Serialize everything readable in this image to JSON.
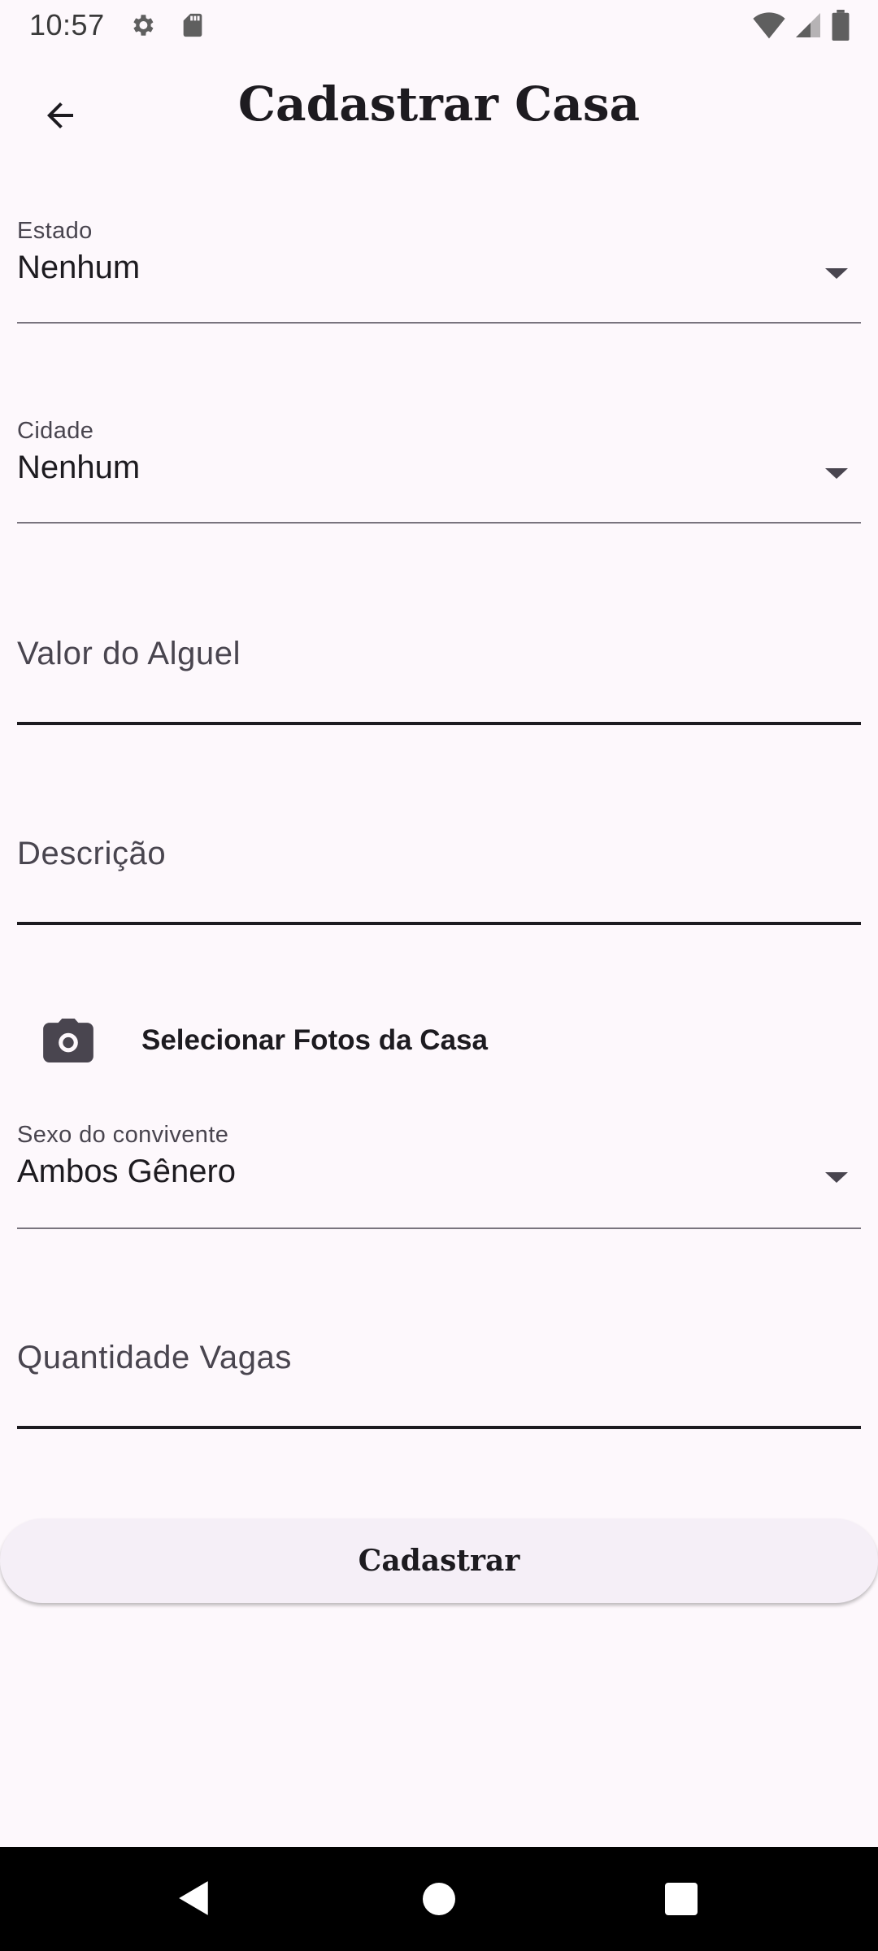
{
  "status_bar": {
    "time": "10:57",
    "icons": [
      "gear-icon",
      "sd-card-icon",
      "wifi-icon",
      "signal-icon",
      "battery-icon"
    ]
  },
  "app_bar": {
    "back_icon": "arrow-left-icon",
    "title": "Cadastrar Casa"
  },
  "form": {
    "estado": {
      "label": "Estado",
      "value": "Nenhum"
    },
    "cidade": {
      "label": "Cidade",
      "value": "Nenhum"
    },
    "valor_aluguel": {
      "placeholder": "Valor do Alguel",
      "value": ""
    },
    "descricao": {
      "placeholder": "Descrição",
      "value": ""
    },
    "photos": {
      "icon": "camera-icon",
      "label": "Selecionar Fotos da Casa"
    },
    "sexo": {
      "label": "Sexo do convivente",
      "value": "Ambos Gênero"
    },
    "vagas": {
      "placeholder": "Quantidade Vagas",
      "value": ""
    },
    "submit_label": "Cadastrar"
  },
  "colors": {
    "background": "#fdf8fc",
    "text": "#1d1b20",
    "button_bg": "#f5eff7"
  }
}
